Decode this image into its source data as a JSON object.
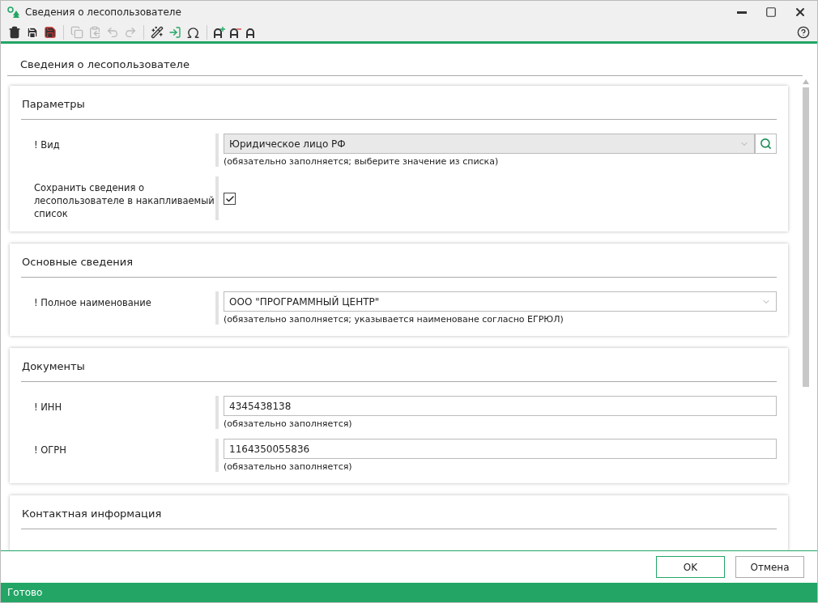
{
  "window": {
    "title": "Сведения о лесопользователе"
  },
  "heading": "Сведения о лесопользователе",
  "sections": [
    {
      "title": "Параметры",
      "fields": [
        {
          "kind": "lookup",
          "label": "! Вид",
          "value": "Юридическое лицо РФ",
          "hint": "(обязательно заполняется; выберите значение из списка)"
        },
        {
          "kind": "checkbox",
          "label": "Сохранить сведения о лесопользователе в накапливаемый список",
          "checked": true
        }
      ]
    },
    {
      "title": "Основные сведения",
      "fields": [
        {
          "kind": "combo",
          "label": "! Полное наименование",
          "value": "ООО \"ПРОГРАММНЫЙ ЦЕНТР\"",
          "hint": "(обязательно заполняется; указывается наименоване согласно ЕГРЮЛ)"
        }
      ]
    },
    {
      "title": "Документы",
      "fields": [
        {
          "kind": "text",
          "label": "! ИНН",
          "value": "4345438138",
          "hint": "(обязательно заполняется)"
        },
        {
          "kind": "text",
          "label": "! ОГРН",
          "value": "1164350055836",
          "hint": "(обязательно заполняется)"
        }
      ]
    },
    {
      "title": "Контактная информация"
    }
  ],
  "buttons": [
    {
      "label": "OK",
      "default": true
    },
    {
      "label": "Отмена",
      "default": false
    }
  ],
  "status_bar": "Готово"
}
